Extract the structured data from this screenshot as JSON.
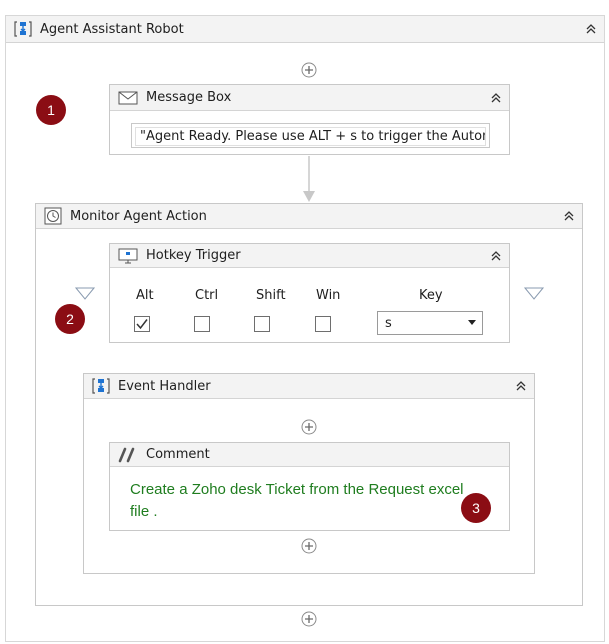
{
  "root": {
    "title": "Agent Assistant Robot",
    "icon": "sequence-icon"
  },
  "message_box": {
    "title": "Message Box",
    "icon": "envelope-icon",
    "text_value": "\"Agent Ready. Please use ALT + s to trigger the Autom"
  },
  "monitor": {
    "title": "Monitor Agent Action",
    "icon": "clock-icon"
  },
  "hotkey": {
    "title": "Hotkey Trigger",
    "icon": "monitor-icon",
    "modifiers": [
      {
        "label": "Alt",
        "checked": true
      },
      {
        "label": "Ctrl",
        "checked": false
      },
      {
        "label": "Shift",
        "checked": false
      },
      {
        "label": "Win",
        "checked": false
      }
    ],
    "key_label": "Key",
    "key_value": "s"
  },
  "event_handler": {
    "title": "Event Handler",
    "icon": "sequence-icon"
  },
  "comment": {
    "title": "Comment",
    "icon": "comment-slashes-icon",
    "text": "Create a Zoho desk Ticket from the Request excel file .",
    "text_color": "#1f7d1f"
  },
  "badges": [
    "1",
    "2",
    "3"
  ],
  "colors": {
    "badge": "#8b0d14",
    "header_bg": "#f3f3f3",
    "border": "#c8c8c8"
  }
}
